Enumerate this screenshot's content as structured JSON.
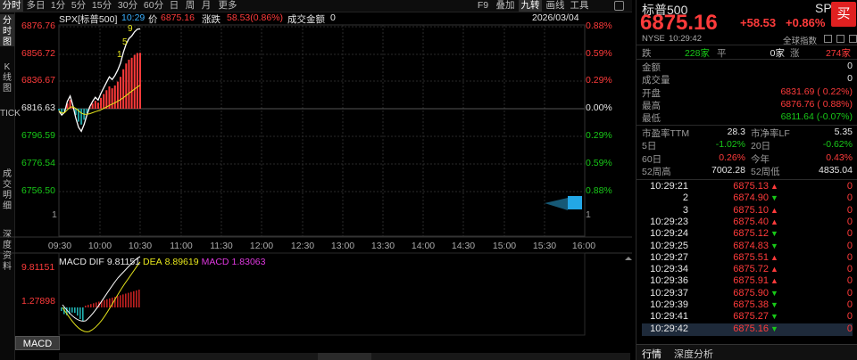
{
  "toolbar": {
    "items": [
      "分时",
      "多日",
      "1分",
      "5分",
      "15分",
      "30分",
      "60分",
      "日",
      "周",
      "月",
      "更多"
    ],
    "right_items": [
      "F9",
      "叠加",
      "九转",
      "画线",
      "工具"
    ]
  },
  "left_tabs": [
    "分时图",
    "K线图",
    "TICK",
    "成交明细",
    "深度资料"
  ],
  "chart": {
    "symbol": "SPX[标普500]",
    "time": "10:29",
    "price_label": "价",
    "price": "6875.16",
    "change_label": "涨跌",
    "change": "58.53(0.86%)",
    "amount_label": "成交金额",
    "amount": "0",
    "date": "2026/03/04",
    "left_axis": [
      "6876.76",
      "6856.72",
      "6836.67",
      "6816.63",
      "6796.59",
      "6776.54",
      "6756.50",
      "1"
    ],
    "right_axis": [
      "0.88%",
      "0.59%",
      "0.29%",
      "0.00%",
      "0.29%",
      "0.59%",
      "0.88%",
      "1"
    ],
    "time_axis": [
      "09:30",
      "10:00",
      "10:30",
      "11:00",
      "11:30",
      "12:00",
      "12:30",
      "13:00",
      "13:30",
      "14:00",
      "14:30",
      "15:00",
      "15:30",
      "16:00"
    ],
    "nine_turn_marks": [
      "9",
      "5",
      "1"
    ],
    "price_series": [
      6815,
      6812,
      6814,
      6822,
      6826,
      6819,
      6810,
      6803,
      6800,
      6805,
      6812,
      6818,
      6822,
      6825,
      6823,
      6828,
      6832,
      6836,
      6840,
      6838,
      6841,
      6845,
      6850,
      6858,
      6864,
      6868,
      6870,
      6873,
      6875,
      6875.16
    ],
    "colors": {
      "up": "#ff3b3b",
      "down": "#18c918",
      "price_line": "#ffffff",
      "avg_line": "#e8e81c"
    }
  },
  "macd": {
    "header_label": "MACD",
    "dif_label": "DIF",
    "dif": "9.81151",
    "dea_label": "DEA",
    "dea": "8.89619",
    "macd_label": "MACD",
    "macd_value": "1.83063",
    "left_axis": [
      "9.81151",
      "1.27898"
    ],
    "tab_label": "MACD"
  },
  "quote": {
    "name": "标普500",
    "code": "SPX",
    "buy_label": "买",
    "price": "6875.16",
    "change": "+58.53",
    "pct": "+0.86%",
    "exchange": "NYSE",
    "time": "10:29:42",
    "index_label": "全球指数",
    "breadth": {
      "down_label": "跌",
      "down": "228家",
      "flat_label": "平",
      "flat": "0家",
      "up_label": "涨",
      "up": "274家"
    },
    "stats": [
      {
        "label": "金额",
        "value": "0",
        "color": "white"
      },
      {
        "label": "成交量",
        "value": "0",
        "color": "white"
      },
      {
        "label": "开盘",
        "value": "6831.69 ( 0.22%)",
        "color": "red"
      },
      {
        "label": "最高",
        "value": "6876.76 ( 0.88%)",
        "color": "red"
      },
      {
        "label": "最低",
        "value": "6811.64 (-0.07%)",
        "color": "green"
      }
    ],
    "metrics": [
      {
        "l1": "市盈率TTM",
        "v1": "28.3",
        "c1": "white",
        "l2": "市净率LF",
        "v2": "5.35",
        "c2": "white"
      },
      {
        "l1": "5日",
        "v1": "-1.02%",
        "c1": "green",
        "l2": "20日",
        "v2": "-0.62%",
        "c2": "green"
      },
      {
        "l1": "60日",
        "v1": "0.26%",
        "c1": "red",
        "l2": "今年",
        "v2": "0.43%",
        "c2": "red"
      },
      {
        "l1": "52周高",
        "v1": "7002.28",
        "c1": "white",
        "l2": "52周低",
        "v2": "4835.04",
        "c2": "white"
      }
    ],
    "ticks": [
      {
        "time": "10:29:21",
        "price": "6875.13",
        "dir": "up",
        "vol": "0"
      },
      {
        "time": "2",
        "price": "6874.90",
        "dir": "down",
        "vol": "0"
      },
      {
        "time": "3",
        "price": "6875.10",
        "dir": "up",
        "vol": "0"
      },
      {
        "time": "10:29:23",
        "price": "6875.40",
        "dir": "up",
        "vol": "0"
      },
      {
        "time": "10:29:24",
        "price": "6875.12",
        "dir": "down",
        "vol": "0"
      },
      {
        "time": "10:29:25",
        "price": "6874.83",
        "dir": "down",
        "vol": "0"
      },
      {
        "time": "10:29:27",
        "price": "6875.51",
        "dir": "up",
        "vol": "0"
      },
      {
        "time": "10:29:34",
        "price": "6875.72",
        "dir": "up",
        "vol": "0"
      },
      {
        "time": "10:29:36",
        "price": "6875.91",
        "dir": "up",
        "vol": "0"
      },
      {
        "time": "10:29:37",
        "price": "6875.90",
        "dir": "down",
        "vol": "0"
      },
      {
        "time": "10:29:39",
        "price": "6875.38",
        "dir": "down",
        "vol": "0"
      },
      {
        "time": "10:29:41",
        "price": "6875.27",
        "dir": "down",
        "vol": "0"
      },
      {
        "time": "10:29:42",
        "price": "6875.16",
        "dir": "down",
        "vol": "0"
      }
    ],
    "bottom_tabs": [
      "行情",
      "深度分析"
    ]
  }
}
